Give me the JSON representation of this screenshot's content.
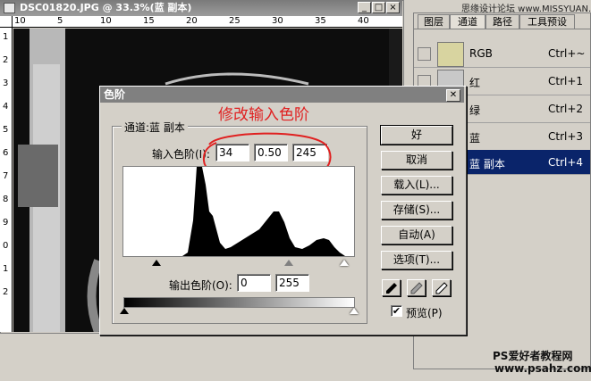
{
  "document": {
    "title": "DSC01820.JPG @ 33.3%(蓝 副本)",
    "ruler_top_numbers": [
      "10",
      "5",
      "10",
      "15",
      "20",
      "25",
      "30",
      "35",
      "40"
    ],
    "ruler_left_numbers": [
      "1",
      "2",
      "3",
      "4",
      "5",
      "6",
      "7",
      "8",
      "9",
      "0",
      "1",
      "2"
    ]
  },
  "watermark_top": "思缘设计论坛 www.MISSYUAN.COM",
  "watermark_bottom": {
    "line1": "PS爱好者教程网",
    "line2": "www.psahz.com"
  },
  "panel": {
    "tabs": [
      "图层",
      "通道",
      "路径",
      "工具预设"
    ],
    "active_tab": 1,
    "channels": [
      {
        "name": "RGB",
        "shortcut": "Ctrl+~"
      },
      {
        "name": "红",
        "shortcut": "Ctrl+1"
      },
      {
        "name": "绿",
        "shortcut": "Ctrl+2"
      },
      {
        "name": "蓝",
        "shortcut": "Ctrl+3"
      },
      {
        "name": "蓝 副本",
        "shortcut": "Ctrl+4",
        "selected": true
      }
    ]
  },
  "levels_dialog": {
    "title": "色阶",
    "channel_label": "通道:蓝 副本",
    "input_label": "输入色阶(I):",
    "input_black": "34",
    "input_gamma": "0.50",
    "input_white": "245",
    "output_label": "输出色阶(O):",
    "output_black": "0",
    "output_white": "255",
    "annotation": "修改输入色阶",
    "buttons": {
      "ok": "好",
      "cancel": "取消",
      "load": "载入(L)...",
      "save": "存储(S)...",
      "auto": "自动(A)",
      "options": "选项(T)..."
    },
    "preview_label": "预览(P)",
    "preview_checked": true,
    "checkmark": "✔",
    "close_glyph": "✕"
  },
  "colors": {
    "annotation": "#e02020",
    "selected_row": "#0a246a",
    "title_gray": "#808080"
  }
}
